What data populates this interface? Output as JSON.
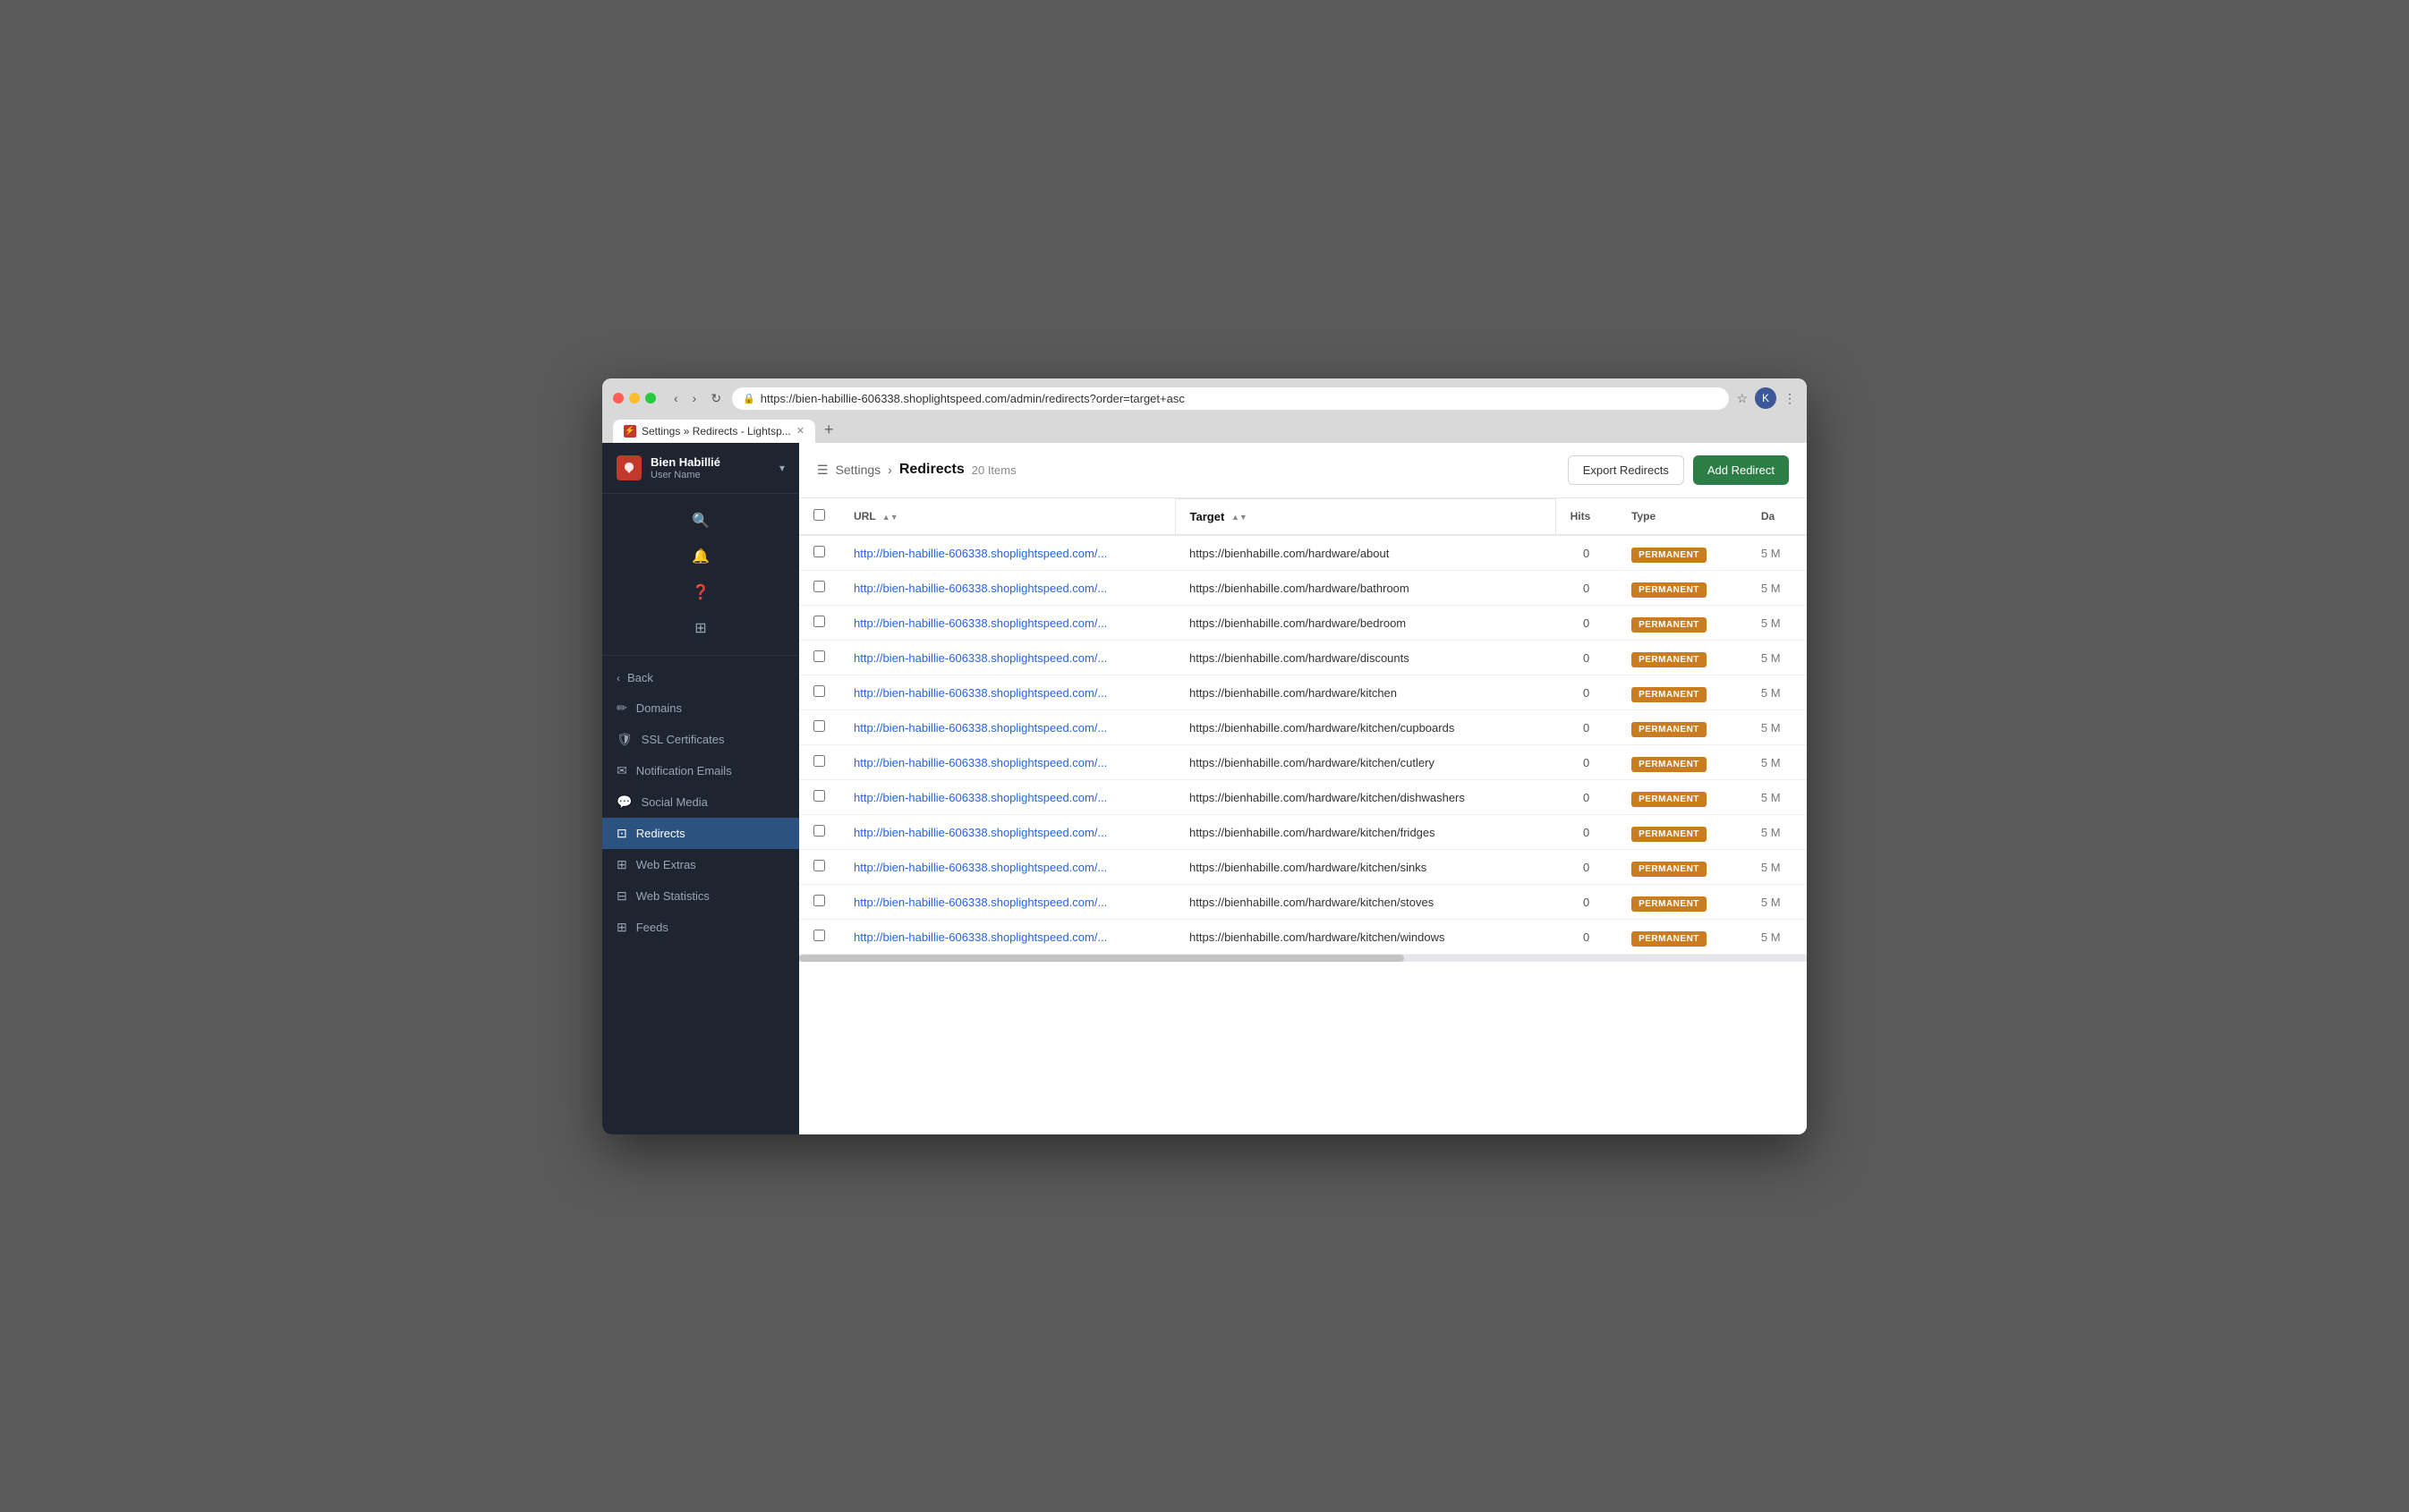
{
  "browser": {
    "url": "https://bien-habillie-606338.shoplightspeed.com/admin/redirects?order=target+asc",
    "tab_title": "Settings » Redirects - Lightsp...",
    "tab_favicon": "⚡"
  },
  "header": {
    "breadcrumb_icon": "☰",
    "breadcrumb_link": "Settings",
    "breadcrumb_sep": "›",
    "breadcrumb_current": "Redirects",
    "item_count": "20 Items",
    "export_btn": "Export Redirects",
    "add_btn": "Add Redirect"
  },
  "sidebar": {
    "brand_name": "Bien Habillié",
    "brand_sub": "User Name",
    "nav_back": "Back",
    "items": [
      {
        "id": "domains",
        "label": "Domains",
        "icon": "✏️"
      },
      {
        "id": "ssl",
        "label": "SSL Certificates",
        "icon": "🛡"
      },
      {
        "id": "notification-emails",
        "label": "Notification Emails",
        "icon": "✉"
      },
      {
        "id": "social-media",
        "label": "Social Media",
        "icon": "💬"
      },
      {
        "id": "redirects",
        "label": "Redirects",
        "icon": "⊡",
        "active": true
      },
      {
        "id": "web-extras",
        "label": "Web Extras",
        "icon": "⊞"
      },
      {
        "id": "web-statistics",
        "label": "Web Statistics",
        "icon": "⊟"
      },
      {
        "id": "feeds",
        "label": "Feeds",
        "icon": "⊞"
      }
    ]
  },
  "table": {
    "columns": {
      "checkbox": "",
      "url": "URL",
      "target": "Target",
      "hits": "Hits",
      "type": "Type",
      "date": "Da"
    },
    "rows": [
      {
        "url": "http://bien-habillie-606338.shoplightspeed.com/...",
        "target": "https://bienhabille.com/hardware/about",
        "hits": "0",
        "type": "PERMANENT",
        "date": "5 M"
      },
      {
        "url": "http://bien-habillie-606338.shoplightspeed.com/...",
        "target": "https://bienhabille.com/hardware/bathroom",
        "hits": "0",
        "type": "PERMANENT",
        "date": "5 M"
      },
      {
        "url": "http://bien-habillie-606338.shoplightspeed.com/...",
        "target": "https://bienhabille.com/hardware/bedroom",
        "hits": "0",
        "type": "PERMANENT",
        "date": "5 M"
      },
      {
        "url": "http://bien-habillie-606338.shoplightspeed.com/...",
        "target": "https://bienhabille.com/hardware/discounts",
        "hits": "0",
        "type": "PERMANENT",
        "date": "5 M"
      },
      {
        "url": "http://bien-habillie-606338.shoplightspeed.com/...",
        "target": "https://bienhabille.com/hardware/kitchen",
        "hits": "0",
        "type": "PERMANENT",
        "date": "5 M"
      },
      {
        "url": "http://bien-habillie-606338.shoplightspeed.com/...",
        "target": "https://bienhabille.com/hardware/kitchen/cupboards",
        "hits": "0",
        "type": "PERMANENT",
        "date": "5 M"
      },
      {
        "url": "http://bien-habillie-606338.shoplightspeed.com/...",
        "target": "https://bienhabille.com/hardware/kitchen/cutlery",
        "hits": "0",
        "type": "PERMANENT",
        "date": "5 M"
      },
      {
        "url": "http://bien-habillie-606338.shoplightspeed.com/...",
        "target": "https://bienhabille.com/hardware/kitchen/dishwashers",
        "hits": "0",
        "type": "PERMANENT",
        "date": "5 M"
      },
      {
        "url": "http://bien-habillie-606338.shoplightspeed.com/...",
        "target": "https://bienhabille.com/hardware/kitchen/fridges",
        "hits": "0",
        "type": "PERMANENT",
        "date": "5 M"
      },
      {
        "url": "http://bien-habillie-606338.shoplightspeed.com/...",
        "target": "https://bienhabille.com/hardware/kitchen/sinks",
        "hits": "0",
        "type": "PERMANENT",
        "date": "5 M"
      },
      {
        "url": "http://bien-habillie-606338.shoplightspeed.com/...",
        "target": "https://bienhabille.com/hardware/kitchen/stoves",
        "hits": "0",
        "type": "PERMANENT",
        "date": "5 M"
      },
      {
        "url": "http://bien-habillie-606338.shoplightspeed.com/...",
        "target": "https://bienhabille.com/hardware/kitchen/windows",
        "hits": "0",
        "type": "PERMANENT",
        "date": "5 M"
      }
    ]
  }
}
